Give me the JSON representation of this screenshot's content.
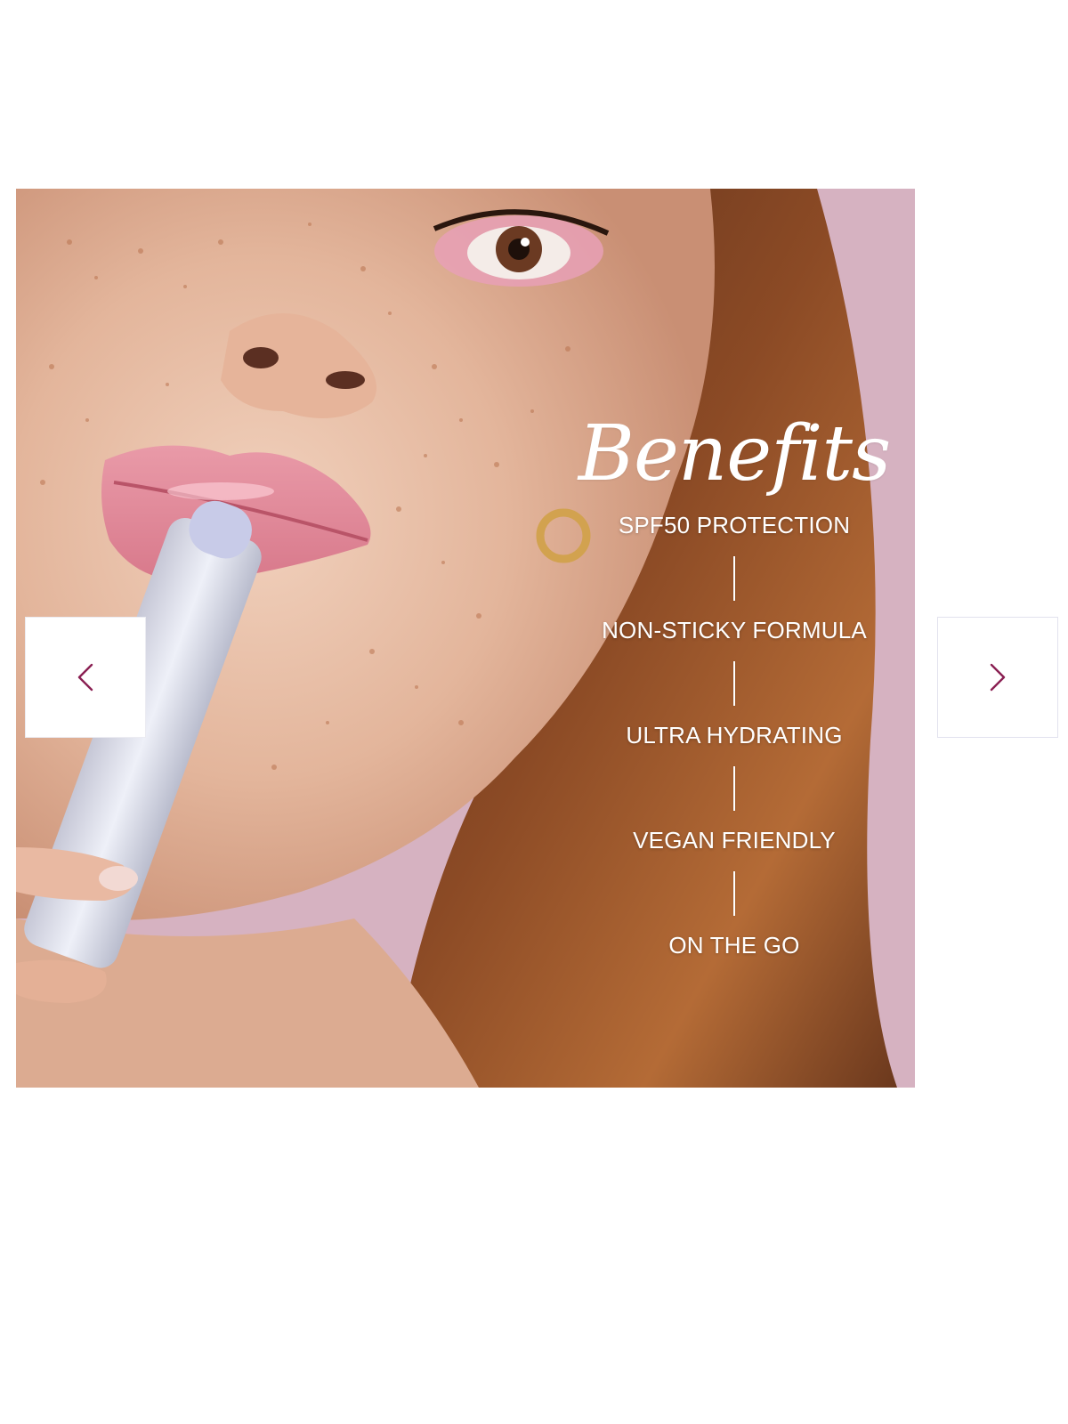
{
  "carousel": {
    "slide": {
      "image_alt": "Model with freckles applying a tinted lip balm tube to her lips against a pink background"
    },
    "benefits": {
      "title": "Benefits",
      "items": [
        "SPF50 PROTECTION",
        "NON-STICKY FORMULA",
        "ULTRA HYDRATING",
        "VEGAN FRIENDLY",
        "ON THE GO"
      ]
    },
    "prev_button": {
      "icon": "chevron-left-icon",
      "aria_label": "Previous slide"
    },
    "next_button": {
      "icon": "chevron-right-icon",
      "aria_label": "Next slide"
    }
  },
  "colors": {
    "background": "#ffffff",
    "arrow": "#8a1f52",
    "overlay_text": "#ffffff",
    "backdrop_pink": "#d7b3c2"
  }
}
